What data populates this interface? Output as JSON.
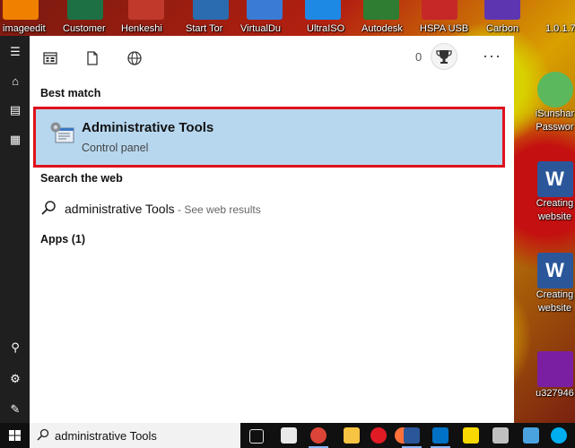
{
  "desktop": {
    "top_icons": [
      {
        "label": "imageedit",
        "icon": "image-editor-app-icon",
        "color": "#f08000"
      },
      {
        "label": "Customer",
        "icon": "excel-file-icon",
        "color": "#1d7044"
      },
      {
        "label": "Henkeshi",
        "icon": "photo-file-icon",
        "color": "#c0392b"
      },
      {
        "label": "Start Tor",
        "icon": "tor-shortcut-icon",
        "color": "#2b6cb0"
      },
      {
        "label": "VirtualDu",
        "icon": "virtualdub-shortcut-icon",
        "color": "#3a7bd5"
      },
      {
        "label": "UltraISO",
        "icon": "ultraiso-shortcut-icon",
        "color": "#1e88e5"
      },
      {
        "label": "Autodesk",
        "icon": "autodesk-shortcut-icon",
        "color": "#2e7d32"
      },
      {
        "label": "HSPA USB",
        "icon": "hspa-usb-shortcut-icon",
        "color": "#c62828"
      },
      {
        "label": "Carbon",
        "icon": "carbon-shortcut-icon",
        "color": "#5e35b1"
      },
      {
        "label": "1.0.1.7",
        "icon": "file-icon",
        "color": "#9e9e9e"
      }
    ],
    "right_items": [
      {
        "label_lines": [
          "iSunshar",
          "Passwor"
        ],
        "icon": "key-app-icon",
        "color": "#5cb85c"
      },
      {
        "label_lines": [
          "Creating",
          "website"
        ],
        "icon": "word-document-icon",
        "color": "#2b579a"
      },
      {
        "label_lines": [
          "Creating",
          "website"
        ],
        "icon": "word-document-icon",
        "color": "#2b579a"
      },
      {
        "label_lines": [
          "u327946"
        ],
        "icon": "winrar-archive-icon",
        "color": "#7b1fa2"
      }
    ]
  },
  "rail": {
    "items": [
      {
        "name": "hamburger-menu-icon",
        "glyph": "☰"
      },
      {
        "name": "home-icon",
        "glyph": "⌂"
      },
      {
        "name": "notebook-icon",
        "glyph": "▤"
      },
      {
        "name": "office-building-icon",
        "glyph": "▦"
      },
      {
        "name": "user-icon",
        "glyph": "👤"
      },
      {
        "name": "settings-gear-icon",
        "glyph": "⚙"
      },
      {
        "name": "feedback-icon",
        "glyph": "✎"
      }
    ]
  },
  "search_panel": {
    "filters": [
      {
        "name": "apps-filter-icon"
      },
      {
        "name": "documents-filter-icon"
      },
      {
        "name": "web-filter-icon"
      }
    ],
    "rewards_count": "0",
    "more_label": "···",
    "best_match_heading": "Best match",
    "best_match": {
      "title": "Administrative Tools",
      "subtitle": "Control panel"
    },
    "search_web_heading": "Search the web",
    "web_result": {
      "query": "administrative Tools",
      "hint": " - See web results"
    },
    "apps_heading": "Apps (1)"
  },
  "taskbar": {
    "search_text": "administrative Tools",
    "apps": [
      {
        "name": "task-view-icon",
        "color": "#e0e0e0"
      },
      {
        "name": "store-icon",
        "color": "#e8e8e8"
      },
      {
        "name": "chrome-icon",
        "color": "#db4437"
      },
      {
        "name": "file-explorer-icon",
        "color": "#f6c342"
      },
      {
        "name": "opera-icon",
        "color": "#e01b24"
      },
      {
        "name": "firefox-icon",
        "color": "#ff7139"
      },
      {
        "name": "word-icon",
        "color": "#2b579a"
      },
      {
        "name": "outlook-icon",
        "color": "#0072c6"
      },
      {
        "name": "sticky-notes-icon",
        "color": "#f7d800"
      },
      {
        "name": "snipping-tool-icon",
        "color": "#c0c0c0"
      },
      {
        "name": "paint-icon",
        "color": "#4aa3df"
      },
      {
        "name": "skype-icon",
        "color": "#00aff0"
      }
    ]
  }
}
